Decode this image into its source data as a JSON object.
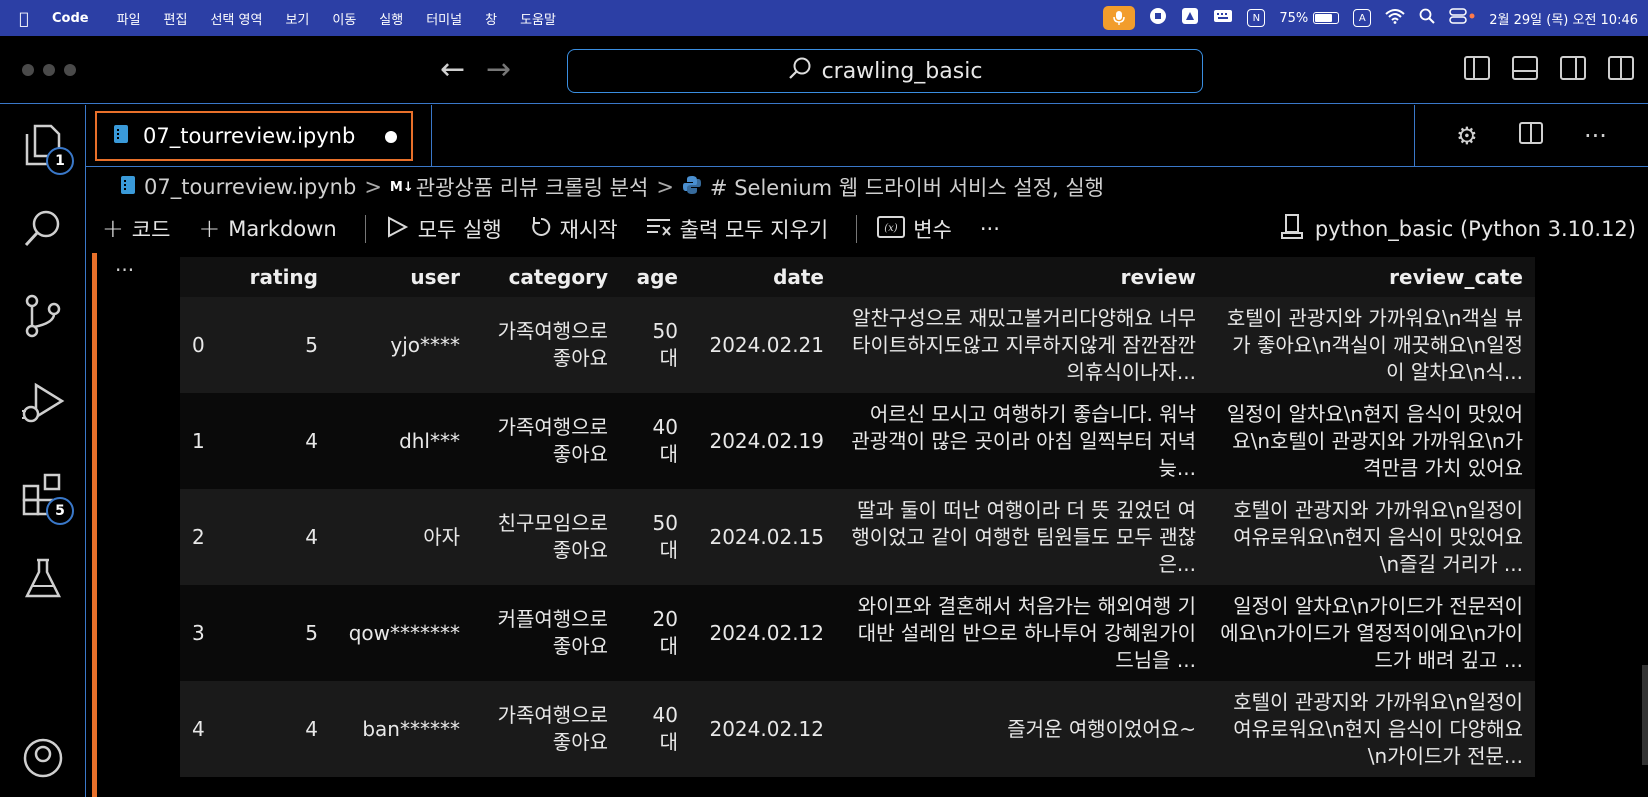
{
  "menubar": {
    "app_name": "Code",
    "items": [
      "파일",
      "편집",
      "선택 영역",
      "보기",
      "이동",
      "실행",
      "터미널",
      "창",
      "도움말"
    ],
    "battery_percent": "75%",
    "battery_level": 0.75,
    "input_source": "A",
    "clock": "2월 29일 (목) 오전 10:46"
  },
  "titlebar": {
    "search_text": "crawling_basic"
  },
  "activity": {
    "explorer_badge": "1",
    "extensions_badge": "5"
  },
  "tab": {
    "filename": "07_tourreview.ipynb"
  },
  "breadcrumb": {
    "file": "07_tourreview.ipynb",
    "md_marker": "M↓",
    "section": "관광상품 리뷰 크롤링 분석",
    "cell": "# Selenium 웹 드라이버 서비스 설정, 실행"
  },
  "toolbar": {
    "code": "코드",
    "markdown": "Markdown",
    "run_all": "모두 실행",
    "restart": "재시작",
    "clear_outputs": "출력 모두 지우기",
    "variables": "변수",
    "more": "···",
    "kernel": "python_basic (Python 3.10.12)"
  },
  "output": {
    "ellipsis": "···",
    "columns": [
      "",
      "rating",
      "user",
      "category",
      "age",
      "date",
      "review",
      "review_cate"
    ],
    "rows": [
      {
        "idx": "0",
        "rating": "5",
        "user": "yjo****",
        "category": "가족여행으로 좋아요",
        "age": "50 대",
        "date": "2024.02.21",
        "review": "알찬구성으로 재밌고볼거리다양해요 너무타이트하지도않고 지루하지않게 잠깐잠깐의휴식이나자...",
        "review_cate": "호텔이 관광지와 가까워요\\n객실 뷰가 좋아요\\n객실이 깨끗해요\\n일정이 알차요\\n식..."
      },
      {
        "idx": "1",
        "rating": "4",
        "user": "dhl***",
        "category": "가족여행으로 좋아요",
        "age": "40 대",
        "date": "2024.02.19",
        "review": "어르신 모시고 여행하기 좋습니다. 워낙 관광객이 많은 곳이라 아침 일찍부터 저녁 늦...",
        "review_cate": "일정이 알차요\\n현지 음식이 맛있어요\\n호텔이 관광지와 가까워요\\n가격만큼 가치 있어요"
      },
      {
        "idx": "2",
        "rating": "4",
        "user": "아자",
        "category": "친구모임으로 좋아요",
        "age": "50 대",
        "date": "2024.02.15",
        "review": "딸과 둘이 떠난 여행이라 더 뜻 깊었던 여행이었고 같이 여행한 팀원들도 모두 괜찮은...",
        "review_cate": "호텔이 관광지와 가까워요\\n일정이 여유로워요\\n현지 음식이 맛있어요\\n즐길 거리가 ..."
      },
      {
        "idx": "3",
        "rating": "5",
        "user": "qow*******",
        "category": "커플여행으로 좋아요",
        "age": "20 대",
        "date": "2024.02.12",
        "review": "와이프와 결혼해서 처음가는 해외여행 기대반 설레임 반으로 하나투어 강혜원가이드님을 ...",
        "review_cate": "일정이 알차요\\n가이드가 전문적이에요\\n가이드가 열정적이에요\\n가이드가 배려 깊고 ..."
      },
      {
        "idx": "4",
        "rating": "4",
        "user": "ban******",
        "category": "가족여행으로 좋아요",
        "age": "40 대",
        "date": "2024.02.12",
        "review": "즐거운 여행이었어요~",
        "review_cate": "호텔이 관광지와 가까워요\\n일정이 여유로워요\\n현지 음식이 다양해요\\n가이드가 전문..."
      }
    ]
  }
}
